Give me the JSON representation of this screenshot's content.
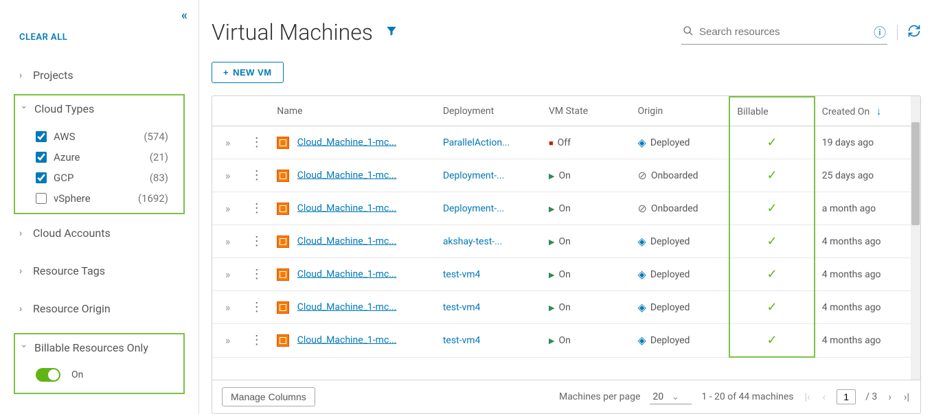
{
  "sidebar": {
    "clear_all": "CLEAR ALL",
    "groups": [
      {
        "label": "Projects",
        "expanded": false
      },
      {
        "label": "Cloud Types",
        "expanded": true,
        "highlight": true,
        "options": [
          {
            "label": "AWS",
            "count": "(574)",
            "checked": true
          },
          {
            "label": "Azure",
            "count": "(21)",
            "checked": true
          },
          {
            "label": "GCP",
            "count": "(83)",
            "checked": true
          },
          {
            "label": "vSphere",
            "count": "(1692)",
            "checked": false
          }
        ]
      },
      {
        "label": "Cloud Accounts",
        "expanded": false
      },
      {
        "label": "Resource Tags",
        "expanded": false
      },
      {
        "label": "Resource Origin",
        "expanded": false
      },
      {
        "label": "Billable Resources Only",
        "expanded": true,
        "highlight": true,
        "toggle": {
          "on": true,
          "label": "On"
        }
      }
    ]
  },
  "header": {
    "title": "Virtual Machines",
    "search_placeholder": "Search resources"
  },
  "toolbar": {
    "new_vm": "NEW VM"
  },
  "table": {
    "columns": {
      "name": "Name",
      "deployment": "Deployment",
      "state": "VM State",
      "origin": "Origin",
      "billable": "Billable",
      "created": "Created On"
    },
    "rows": [
      {
        "name": "Cloud_Machine_1-mc...",
        "deployment": "ParallelAction...",
        "state": "Off",
        "origin": "Deployed",
        "billable": true,
        "created": "19 days ago"
      },
      {
        "name": "Cloud_Machine_1-mc...",
        "deployment": "Deployment-...",
        "state": "On",
        "origin": "Onboarded",
        "billable": true,
        "created": "25 days ago"
      },
      {
        "name": "Cloud_Machine_1-mc...",
        "deployment": "Deployment-...",
        "state": "On",
        "origin": "Onboarded",
        "billable": true,
        "created": "a month ago"
      },
      {
        "name": "Cloud_Machine_1-mc...",
        "deployment": "akshay-test-...",
        "state": "On",
        "origin": "Deployed",
        "billable": true,
        "created": "4 months ago"
      },
      {
        "name": "Cloud_Machine_1-mc...",
        "deployment": "test-vm4",
        "state": "On",
        "origin": "Deployed",
        "billable": true,
        "created": "4 months ago"
      },
      {
        "name": "Cloud_Machine_1-mc...",
        "deployment": "test-vm4",
        "state": "On",
        "origin": "Deployed",
        "billable": true,
        "created": "4 months ago"
      },
      {
        "name": "Cloud_Machine_1-mc...",
        "deployment": "test-vm4",
        "state": "On",
        "origin": "Deployed",
        "billable": true,
        "created": "4 months ago"
      }
    ]
  },
  "footer": {
    "manage_columns": "Manage Columns",
    "per_page_label": "Machines per page",
    "per_page_value": "20",
    "range_text": "1 - 20 of 44 machines",
    "page_current": "1",
    "page_total": "/ 3"
  }
}
